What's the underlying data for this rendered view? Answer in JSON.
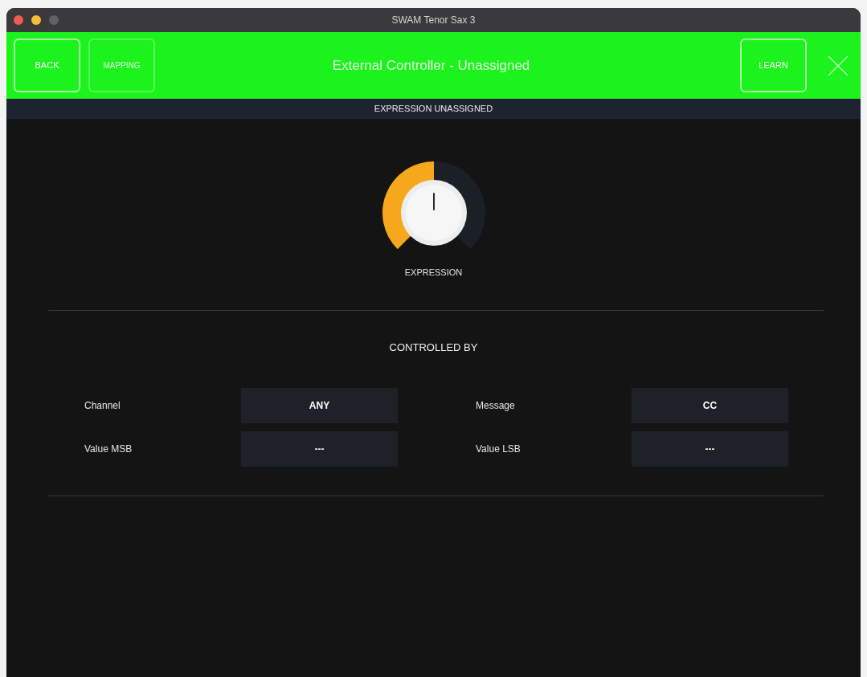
{
  "window": {
    "title": "SWAM Tenor Sax 3"
  },
  "header": {
    "left_buttons": [
      {
        "label": "BACK",
        "disabled": false
      },
      {
        "label": "MAPPING",
        "disabled": true
      }
    ],
    "title": "External Controller - Unassigned",
    "right_buttons": [
      {
        "label": "LEARN",
        "disabled": false
      }
    ]
  },
  "status_bar": {
    "text": "EXPRESSION UNASSIGNED"
  },
  "knob": {
    "label": "EXPRESSION",
    "level": 0.5
  },
  "controlled_by": {
    "heading": "CONTROLLED BY",
    "fields": [
      {
        "label": "Channel",
        "value": "ANY"
      },
      {
        "label": "Message",
        "value": "CC"
      },
      {
        "label": "Value MSB",
        "value": "---"
      },
      {
        "label": "Value LSB",
        "value": "---"
      }
    ]
  }
}
